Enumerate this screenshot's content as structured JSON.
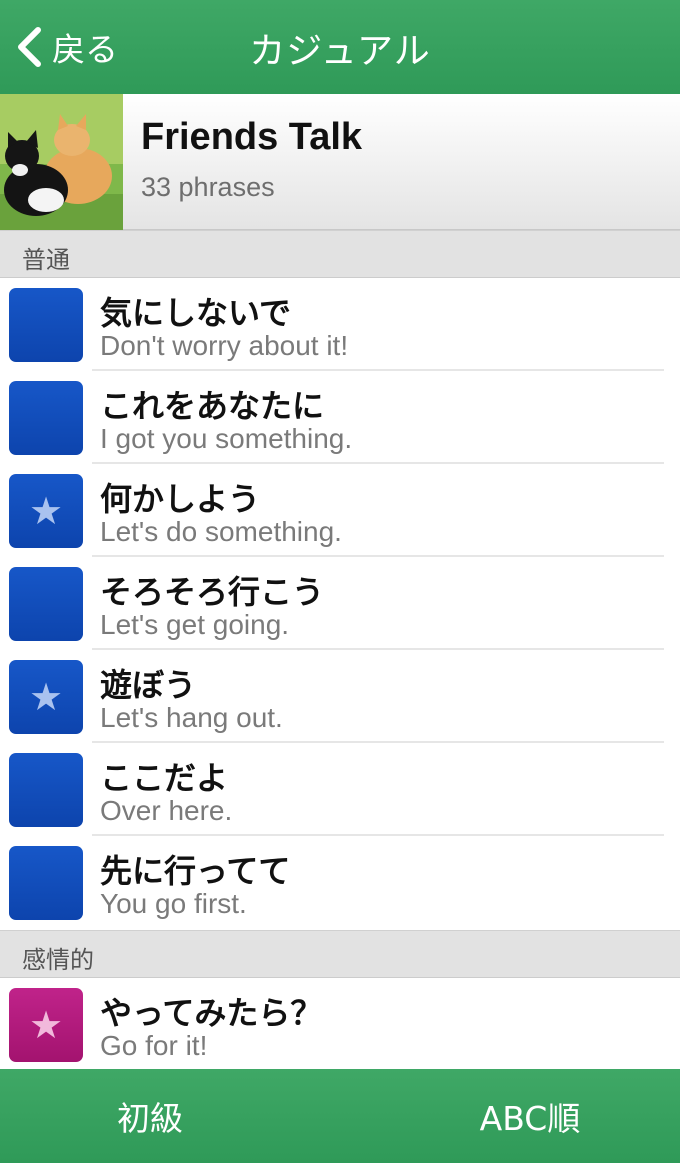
{
  "nav": {
    "back_label": "戻る",
    "title": "カジュアル"
  },
  "header": {
    "title": "Friends Talk",
    "count": "33 phrases"
  },
  "sections": [
    {
      "title": "普通",
      "rows": [
        {
          "jp": "気にしないで",
          "en": "Don't worry about it!",
          "starred": false
        },
        {
          "jp": "これをあなたに",
          "en": "I got you something.",
          "starred": false
        },
        {
          "jp": "何かしよう",
          "en": "Let's do something.",
          "starred": true
        },
        {
          "jp": "そろそろ行こう",
          "en": "Let's get going.",
          "starred": false
        },
        {
          "jp": "遊ぼう",
          "en": "Let's hang out.",
          "starred": true
        },
        {
          "jp": "ここだよ",
          "en": "Over here.",
          "starred": false
        },
        {
          "jp": "先に行ってて",
          "en": "You go first.",
          "starred": false
        }
      ]
    },
    {
      "title": "感情的",
      "rows": [
        {
          "jp": "やってみたら？",
          "en": "Go for it!",
          "starred": true
        }
      ]
    }
  ],
  "tabbar": {
    "left_label": "初級",
    "right_label": "ABC順"
  },
  "colors": {
    "green": "#35a05e",
    "blue_badge": "#1252bf",
    "pink_badge": "#b51c80"
  },
  "icons": {
    "star": "★"
  }
}
